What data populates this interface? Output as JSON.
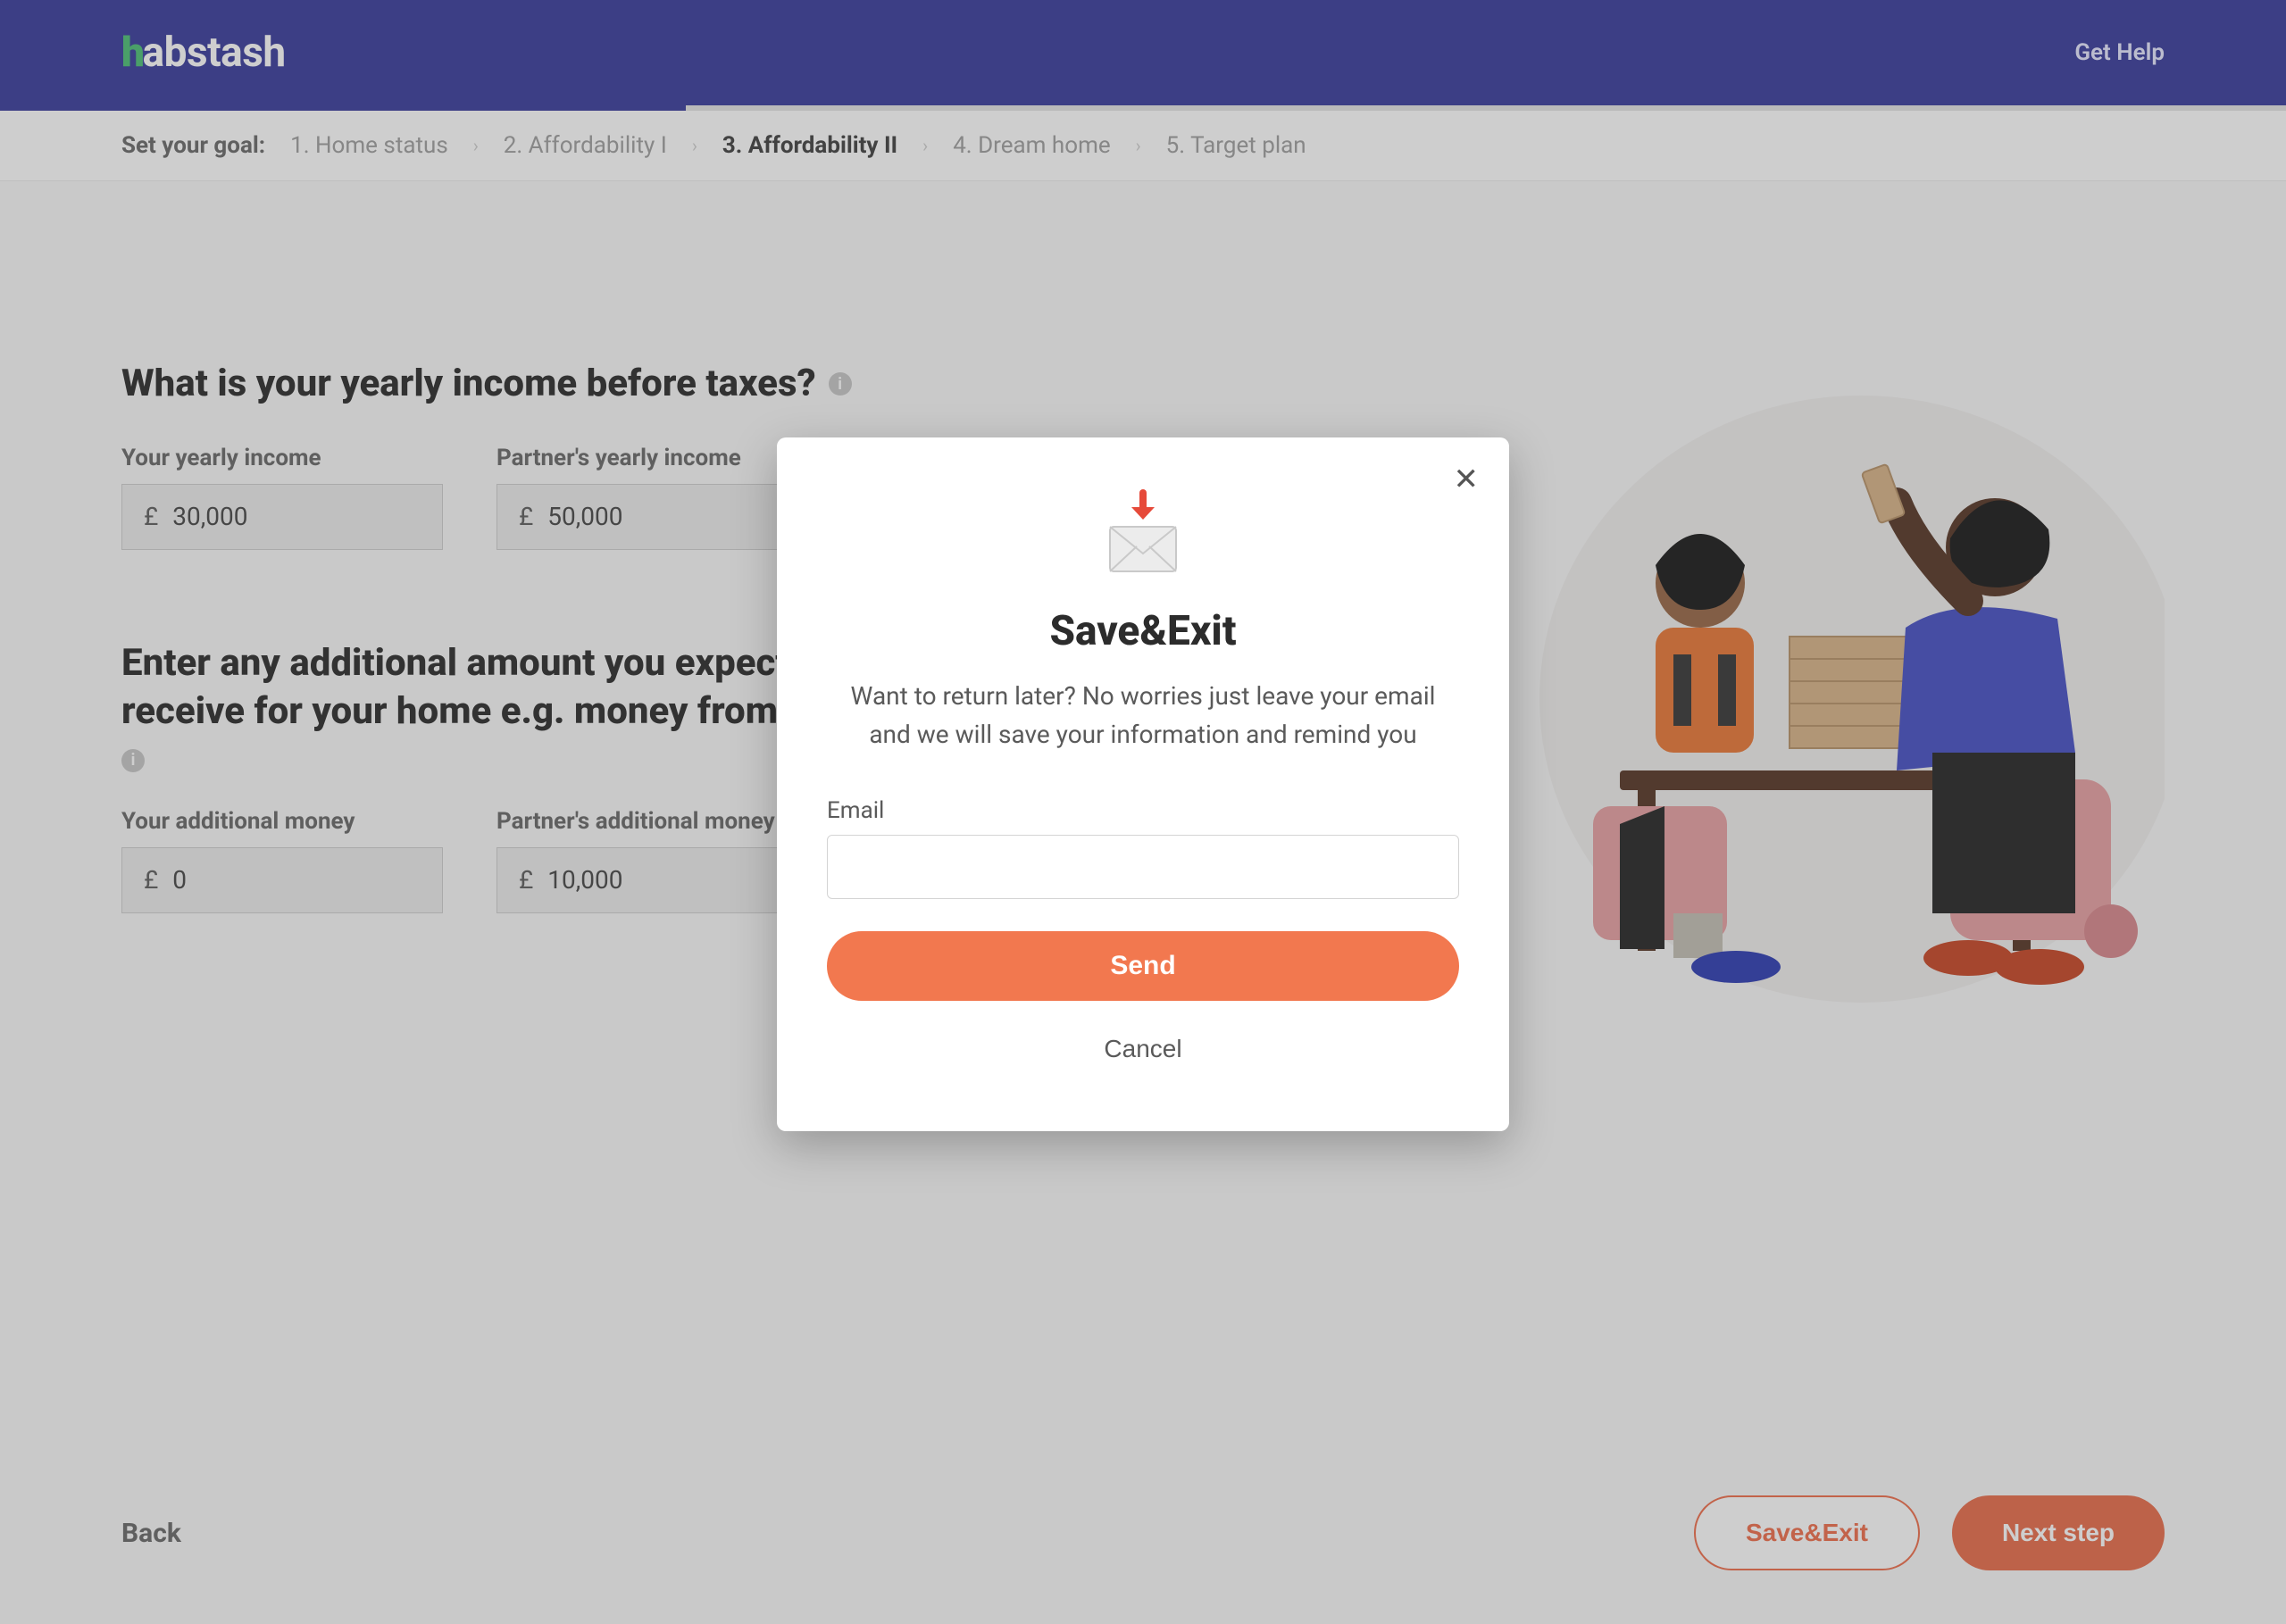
{
  "header": {
    "logo_prefix": "h",
    "logo_rest": "abstash",
    "help": "Get Help"
  },
  "breadcrumb": {
    "label": "Set your goal:",
    "steps": [
      {
        "label": "1. Home status",
        "current": false
      },
      {
        "label": "2. Affordability I",
        "current": false
      },
      {
        "label": "3. Affordability II",
        "current": true
      },
      {
        "label": "4. Dream home",
        "current": false
      },
      {
        "label": "5. Target plan",
        "current": false
      }
    ]
  },
  "questions": {
    "q1": "What is your yearly income before taxes?",
    "q2": "Enter any additional amount you expect to receive for your home e.g. money from family"
  },
  "fields": {
    "currency": "£",
    "your_income_label": "Your yearly income",
    "your_income_value": "30,000",
    "partner_income_label": "Partner's yearly income",
    "partner_income_value": "50,000",
    "your_additional_label": "Your additional money",
    "your_additional_value": "0",
    "partner_additional_label": "Partner's additional money",
    "partner_additional_value": "10,000"
  },
  "footer": {
    "back": "Back",
    "save_exit": "Save&Exit",
    "next": "Next step"
  },
  "modal": {
    "title": "Save&Exit",
    "desc": "Want to return later? No worries just leave your email and we will save your information and remind you",
    "email_label": "Email",
    "send": "Send",
    "cancel": "Cancel"
  },
  "colors": {
    "brand_purple": "#3d3f9e",
    "brand_green": "#4fc078",
    "accent_orange": "#ef704f"
  }
}
